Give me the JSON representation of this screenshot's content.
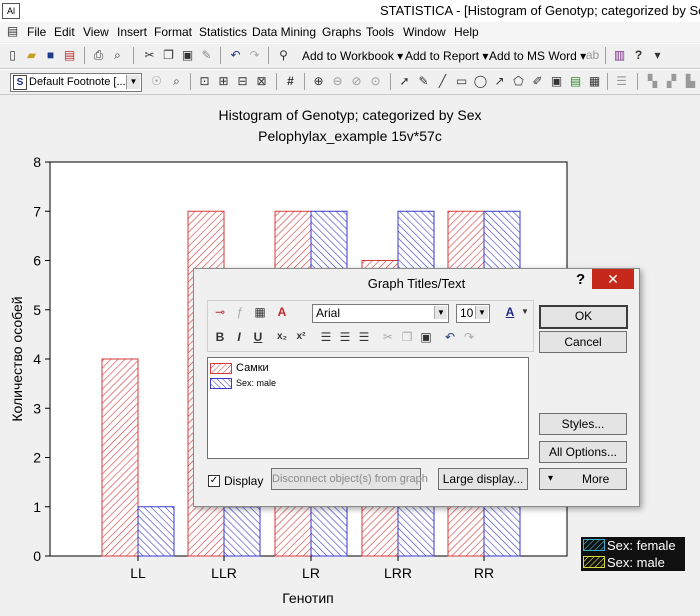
{
  "window": {
    "app_icon": "Al",
    "title": "STATISTICA - [Histogram of Genotyp; categorized by Sex"
  },
  "menu": [
    "File",
    "Edit",
    "View",
    "Insert",
    "Format",
    "Statistics",
    "Data Mining",
    "Graphs",
    "Tools",
    "Window",
    "Help"
  ],
  "toolbar1": {
    "add_workbook": "Add to Workbook ▾",
    "add_report": "Add to Report ▾",
    "add_msword": "Add to MS Word ▾"
  },
  "toolbar2": {
    "footnote_value": "Default Footnote [..."
  },
  "graph": {
    "title": "Histogram of Genotyp; categorized by Sex",
    "subtitle": "Pelophylax_example 15v*57c"
  },
  "chart_data": {
    "type": "bar",
    "categories": [
      "LL",
      "LLR",
      "LR",
      "LRR",
      "RR"
    ],
    "series": [
      {
        "name": "Sex: female",
        "values": [
          4,
          7,
          7,
          6,
          7
        ],
        "color": "#d83a3a"
      },
      {
        "name": "Sex: male",
        "values": [
          1,
          1,
          7,
          7,
          7
        ],
        "color": "#3a3ac8"
      }
    ],
    "xlabel": "Генотип",
    "ylabel": "Количество особей",
    "ylim": [
      0,
      8
    ],
    "yticks": [
      0,
      1,
      2,
      3,
      4,
      5,
      6,
      7,
      8
    ],
    "legend": "bottom-right"
  },
  "dialog": {
    "title": "Graph Titles/Text",
    "help": "?",
    "close": "✕",
    "font_value": "Arial",
    "size_value": "10",
    "bold": "B",
    "italic": "I",
    "underline": "U",
    "subscript": "x₂",
    "superscript": "x²",
    "editor_line1": "Самки",
    "editor_line2": "Sex: male",
    "display_label": "Display",
    "display_checked": "✓",
    "disconnect_label": "Disconnect object(s) from graph",
    "large_display_label": "Large display...",
    "ok_label": "OK",
    "cancel_label": "Cancel",
    "styles_label": "Styles...",
    "all_options_label": "All Options...",
    "more_label": "More",
    "more_arrow": "▾"
  }
}
